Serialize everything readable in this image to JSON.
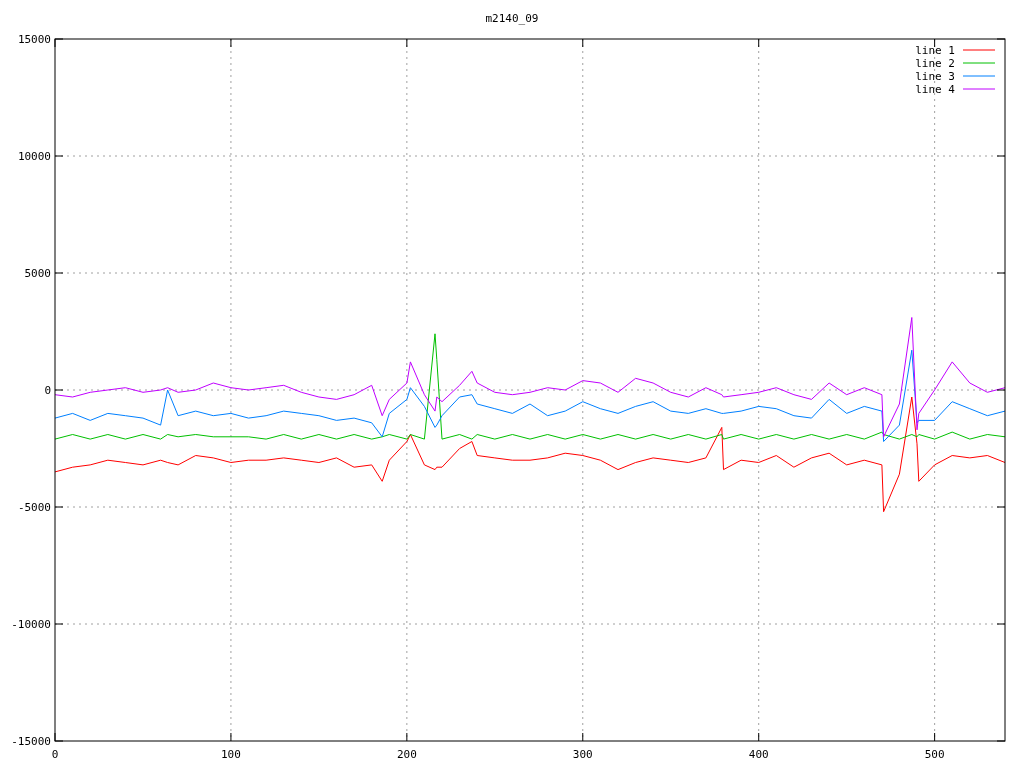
{
  "chart_data": {
    "type": "line",
    "title": "m2140_09",
    "grid": true,
    "legend": true,
    "xlim": [
      0,
      540
    ],
    "ylim": [
      -15000,
      15000
    ],
    "xticks": [
      0,
      100,
      200,
      300,
      400,
      500
    ],
    "yticks": [
      -15000,
      -10000,
      -5000,
      0,
      5000,
      10000,
      15000
    ],
    "x": [
      0,
      10,
      20,
      30,
      40,
      50,
      60,
      64,
      70,
      80,
      90,
      100,
      110,
      120,
      130,
      140,
      150,
      160,
      170,
      180,
      186,
      190,
      200,
      202,
      210,
      216,
      217,
      220,
      230,
      237,
      240,
      250,
      260,
      270,
      280,
      290,
      300,
      310,
      320,
      330,
      340,
      350,
      360,
      370,
      379,
      380,
      390,
      400,
      410,
      420,
      430,
      440,
      450,
      460,
      470,
      471,
      480,
      487,
      490,
      491,
      500,
      510,
      520,
      530,
      540
    ],
    "series": [
      {
        "name": "line 1",
        "color": "#ff0000",
        "values": [
          -3500,
          -3300,
          -3200,
          -3000,
          -3100,
          -3200,
          -3000,
          -3100,
          -3200,
          -2800,
          -2900,
          -3100,
          -3000,
          -3000,
          -2900,
          -3000,
          -3100,
          -2900,
          -3300,
          -3200,
          -3900,
          -3000,
          -2200,
          -1900,
          -3200,
          -3400,
          -3300,
          -3300,
          -2500,
          -2200,
          -2800,
          -2900,
          -3000,
          -3000,
          -2900,
          -2700,
          -2800,
          -3000,
          -3400,
          -3100,
          -2900,
          -3000,
          -3100,
          -2900,
          -1600,
          -3400,
          -3000,
          -3100,
          -2800,
          -3300,
          -2900,
          -2700,
          -3200,
          -3000,
          -3200,
          -5200,
          -3600,
          -300,
          -2300,
          -3900,
          -3200,
          -2800,
          -2900,
          -2800,
          -3100
        ]
      },
      {
        "name": "line 2",
        "color": "#00c000",
        "values": [
          -2100,
          -1900,
          -2100,
          -1900,
          -2100,
          -1900,
          -2100,
          -1900,
          -2000,
          -1900,
          -2000,
          -2000,
          -2000,
          -2100,
          -1900,
          -2100,
          -1900,
          -2100,
          -1900,
          -2100,
          -2000,
          -1900,
          -2100,
          -1900,
          -2100,
          2400,
          1300,
          -2100,
          -1900,
          -2100,
          -1900,
          -2100,
          -1900,
          -2100,
          -1900,
          -2100,
          -1900,
          -2100,
          -1900,
          -2100,
          -1900,
          -2100,
          -1900,
          -2100,
          -1900,
          -2100,
          -1900,
          -2100,
          -1900,
          -2100,
          -1900,
          -2100,
          -1900,
          -2100,
          -1800,
          -1900,
          -2100,
          -1900,
          -2000,
          -1900,
          -2100,
          -1800,
          -2100,
          -1900,
          -2000
        ]
      },
      {
        "name": "line 3",
        "color": "#0080ff",
        "values": [
          -1200,
          -1000,
          -1300,
          -1000,
          -1100,
          -1200,
          -1500,
          0,
          -1100,
          -900,
          -1100,
          -1000,
          -1200,
          -1100,
          -900,
          -1000,
          -1100,
          -1300,
          -1200,
          -1400,
          -2000,
          -1000,
          -400,
          100,
          -700,
          -1600,
          -1500,
          -1100,
          -300,
          -200,
          -600,
          -800,
          -1000,
          -600,
          -1100,
          -900,
          -500,
          -800,
          -1000,
          -700,
          -500,
          -900,
          -1000,
          -800,
          -1000,
          -1000,
          -900,
          -700,
          -800,
          -1100,
          -1200,
          -400,
          -1000,
          -700,
          -900,
          -2200,
          -1500,
          1700,
          -1400,
          -1300,
          -1300,
          -500,
          -800,
          -1100,
          -900
        ]
      },
      {
        "name": "line 4",
        "color": "#c000ff",
        "values": [
          -200,
          -300,
          -100,
          0,
          100,
          -100,
          0,
          100,
          -100,
          0,
          300,
          100,
          0,
          100,
          200,
          -100,
          -300,
          -400,
          -200,
          200,
          -1100,
          -400,
          300,
          1200,
          -200,
          -900,
          -300,
          -500,
          200,
          800,
          300,
          -100,
          -200,
          -100,
          100,
          0,
          400,
          300,
          -100,
          500,
          300,
          -100,
          -300,
          100,
          -200,
          -300,
          -200,
          -100,
          100,
          -200,
          -400,
          300,
          -200,
          100,
          -200,
          -2000,
          -600,
          3100,
          -1700,
          -1000,
          0,
          1200,
          300,
          -100,
          100
        ]
      }
    ]
  }
}
